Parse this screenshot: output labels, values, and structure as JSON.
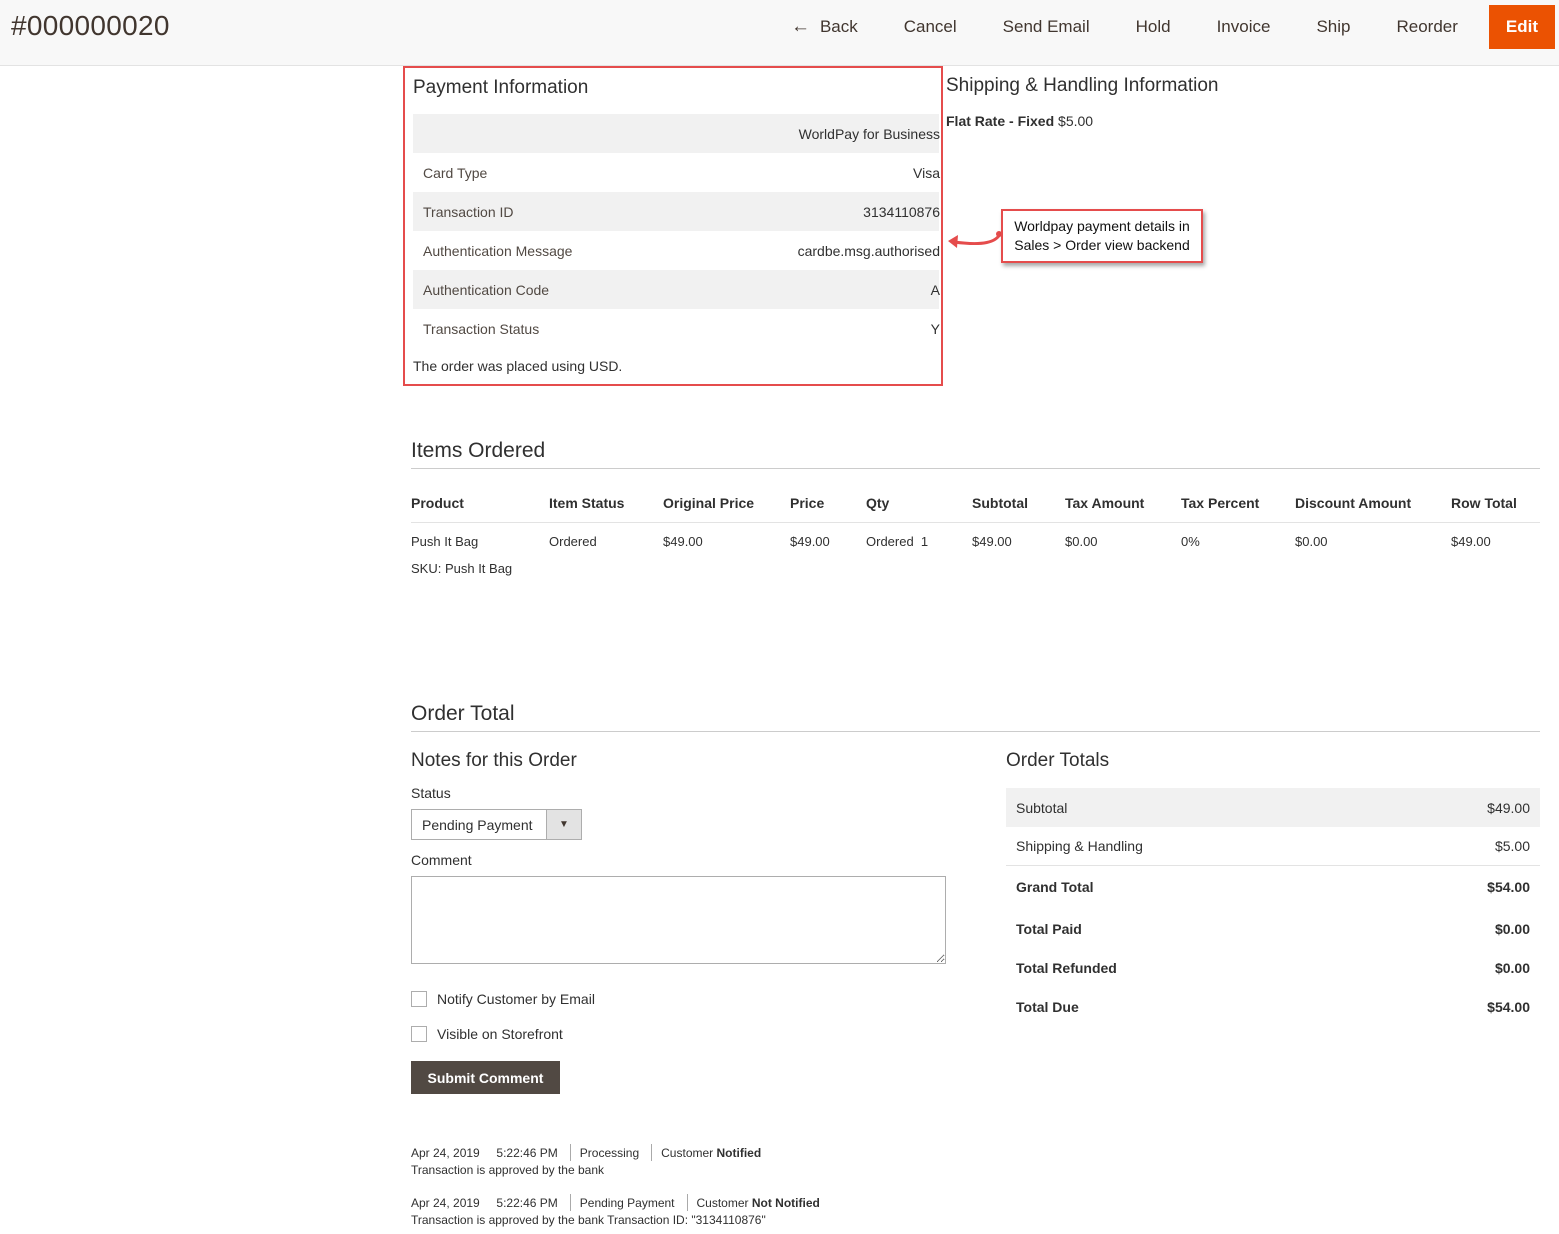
{
  "header": {
    "order_number": "#000000020",
    "actions": {
      "back": "Back",
      "cancel": "Cancel",
      "send_email": "Send Email",
      "hold": "Hold",
      "invoice": "Invoice",
      "ship": "Ship",
      "reorder": "Reorder",
      "edit": "Edit"
    }
  },
  "payment": {
    "title": "Payment Information",
    "method": "WorldPay for Business",
    "rows": [
      {
        "label": "Card Type",
        "value": "Visa"
      },
      {
        "label": "Transaction ID",
        "value": "3134110876"
      },
      {
        "label": "Authentication Message",
        "value": "cardbe.msg.authorised"
      },
      {
        "label": "Authentication Code",
        "value": "A"
      },
      {
        "label": "Transaction Status",
        "value": "Y"
      }
    ],
    "currency_note": "The order was placed using USD."
  },
  "shipping": {
    "title": "Shipping & Handling Information",
    "method": "Flat Rate - Fixed",
    "price": "$5.00"
  },
  "callout": {
    "line1": "Worldpay payment details in",
    "line2": "Sales > Order view backend"
  },
  "items": {
    "title": "Items Ordered",
    "columns": [
      "Product",
      "Item Status",
      "Original Price",
      "Price",
      "Qty",
      "Subtotal",
      "Tax Amount",
      "Tax Percent",
      "Discount Amount",
      "Row Total"
    ],
    "rows": [
      {
        "product": "Push It Bag",
        "sku": "SKU: Push It Bag",
        "item_status": "Ordered",
        "original_price": "$49.00",
        "price": "$49.00",
        "qty": "Ordered  1",
        "subtotal": "$49.00",
        "tax_amount": "$0.00",
        "tax_percent": "0%",
        "discount_amount": "$0.00",
        "row_total": "$49.00"
      }
    ]
  },
  "order_total": {
    "title": "Order Total",
    "notes": {
      "title": "Notes for this Order",
      "status_label": "Status",
      "status_value": "Pending Payment",
      "comment_label": "Comment",
      "notify_label": "Notify Customer by Email",
      "visible_label": "Visible on Storefront",
      "submit_label": "Submit Comment"
    },
    "history": [
      {
        "date": "Apr 24, 2019",
        "time": "5:22:46 PM",
        "status": "Processing",
        "customer": "Customer",
        "notified": "Notified",
        "comment": "Transaction is approved by the bank"
      },
      {
        "date": "Apr 24, 2019",
        "time": "5:22:46 PM",
        "status": "Pending Payment",
        "customer": "Customer",
        "notified": "Not Notified",
        "comment": "Transaction is approved by the bank Transaction ID: \"3134110876\""
      }
    ],
    "totals": {
      "title": "Order Totals",
      "rows": [
        {
          "label": "Subtotal",
          "value": "$49.00"
        },
        {
          "label": "Shipping & Handling",
          "value": "$5.00"
        },
        {
          "label": "Grand Total",
          "value": "$54.00"
        },
        {
          "label": "Total Paid",
          "value": "$0.00"
        },
        {
          "label": "Total Refunded",
          "value": "$0.00"
        },
        {
          "label": "Total Due",
          "value": "$54.00"
        }
      ]
    }
  },
  "colors": {
    "accent": "#eb5202",
    "highlight_border": "#e54c4c",
    "dark_button": "#514943"
  }
}
